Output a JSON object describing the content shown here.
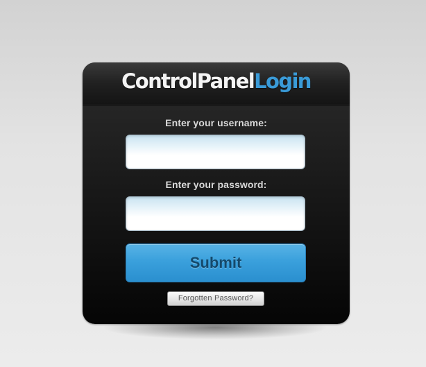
{
  "login_panel": {
    "title_part1": "ControlPanel",
    "title_part2": "Login",
    "username_label": "Enter your username:",
    "username_value": "",
    "password_label": "Enter your password:",
    "password_value": "",
    "submit_label": "Submit",
    "forgot_label": "Forgotten Password?"
  },
  "colors": {
    "accent": "#3a9bd8",
    "panel_bg": "#1a1a1a",
    "submit_text": "#14496b"
  }
}
